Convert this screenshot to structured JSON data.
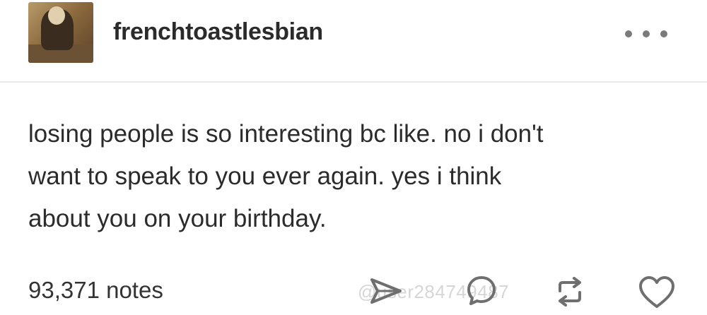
{
  "post": {
    "author": "frenchtoastlesbian",
    "body_lines": [
      "losing people is so interesting bc like. no i don't",
      "want to speak to you ever again. yes i think",
      "about you on your birthday."
    ]
  },
  "footer": {
    "notes": "93,371 notes",
    "watermark": "@user284749487"
  },
  "icons": {
    "more": "more-dots-icon",
    "share": "share-icon",
    "reply": "reply-icon",
    "reblog": "reblog-icon",
    "like": "heart-icon"
  },
  "colors": {
    "text": "#2b2b2b",
    "icon": "#6f6f6f",
    "divider": "#e8e8e8"
  }
}
